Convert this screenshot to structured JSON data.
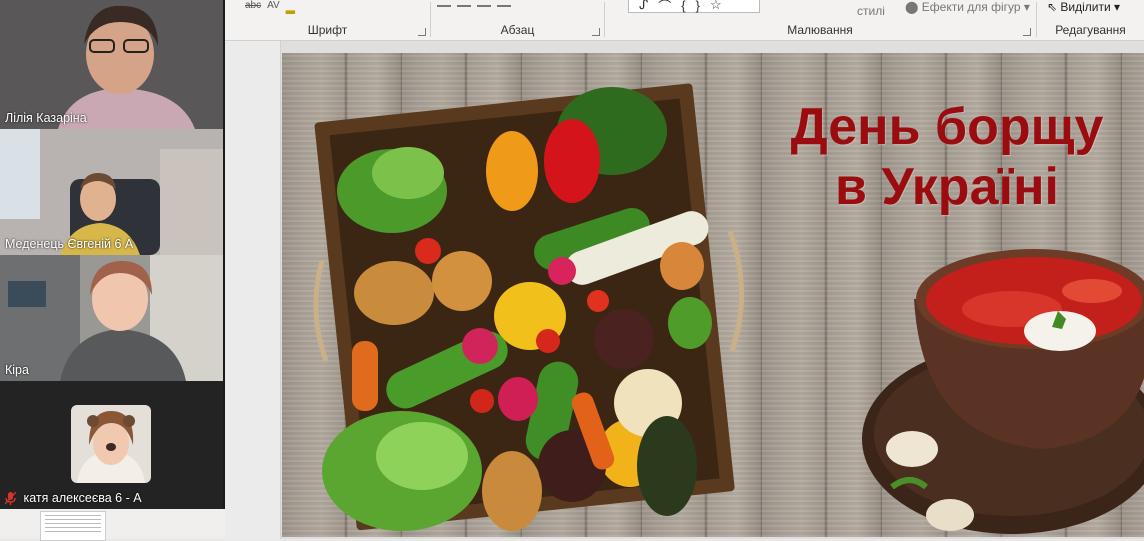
{
  "ribbon": {
    "groups": {
      "font": "Шрифт",
      "paragraph": "Абзац",
      "drawing": "Малювання",
      "editing": "Редагування"
    },
    "styles_label": "стилі",
    "effects_label": "Ефекти для фігур",
    "select_label": "Виділити"
  },
  "slide": {
    "title_line1": "День борщу",
    "title_line2": "в Україні",
    "title_color": "#9b0c10"
  },
  "participants": [
    {
      "name": "Лілія Казаріна",
      "active": true
    },
    {
      "name": "Меденець Євгеній 6 А",
      "active": false
    },
    {
      "name": "Кіра",
      "active": false
    },
    {
      "name": "катя алексеєва 6 - А",
      "active": false,
      "muted": true
    }
  ],
  "colors": {
    "active_speaker": "#22d27a",
    "mute": "#d9332b"
  }
}
